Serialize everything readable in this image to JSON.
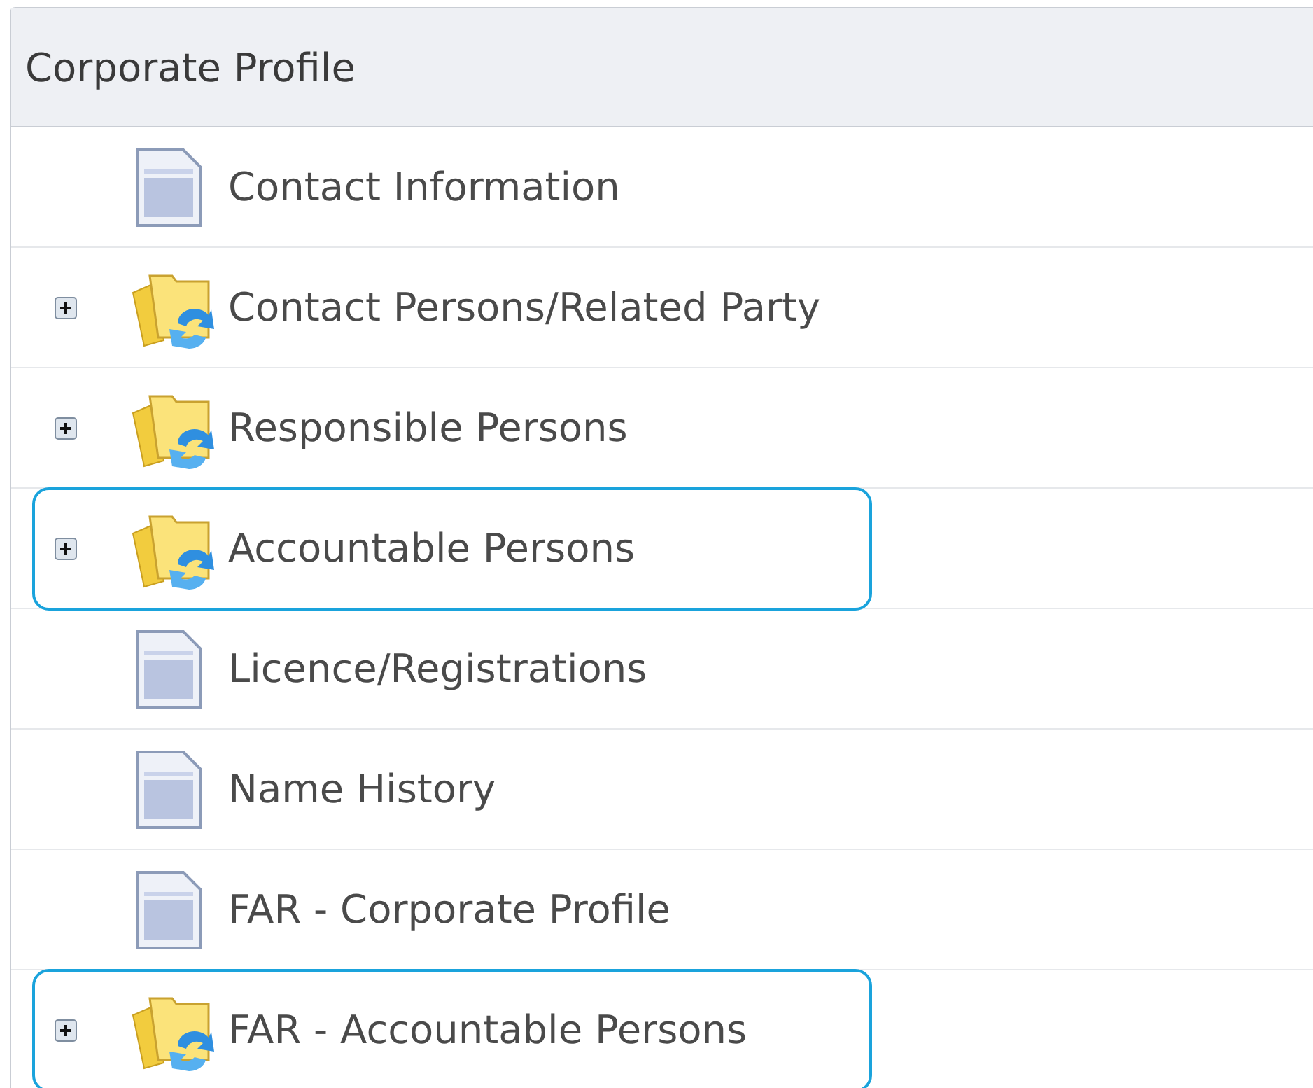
{
  "panel": {
    "title": "Corporate Profile",
    "items": [
      {
        "label": "Contact Information",
        "kind": "document",
        "expandable": false,
        "highlighted": false
      },
      {
        "label": "Contact Persons/Related Party",
        "kind": "folder",
        "expandable": true,
        "highlighted": false
      },
      {
        "label": "Responsible Persons",
        "kind": "folder",
        "expandable": true,
        "highlighted": false
      },
      {
        "label": "Accountable Persons",
        "kind": "folder",
        "expandable": true,
        "highlighted": true
      },
      {
        "label": "Licence/Registrations",
        "kind": "document",
        "expandable": false,
        "highlighted": false
      },
      {
        "label": "Name History",
        "kind": "document",
        "expandable": false,
        "highlighted": false
      },
      {
        "label": "FAR - Corporate Profile",
        "kind": "document",
        "expandable": false,
        "highlighted": false
      },
      {
        "label": "FAR - Accountable Persons",
        "kind": "folder",
        "expandable": true,
        "highlighted": true
      }
    ]
  }
}
